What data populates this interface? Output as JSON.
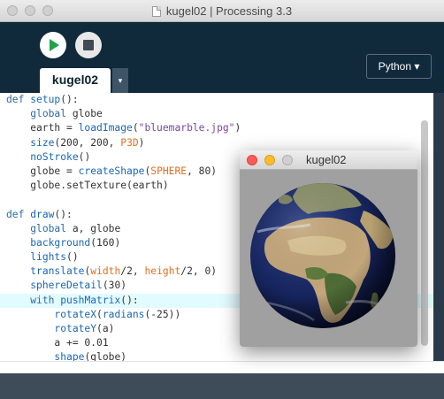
{
  "window": {
    "title": "kugel02 | Processing 3.3"
  },
  "toolbar": {
    "run_label": "Run",
    "stop_label": "Stop",
    "mode_label": "Python ▾"
  },
  "tabs": [
    {
      "label": "kugel02"
    }
  ],
  "tab_menu_glyph": "▾",
  "code_lines": [
    "def setup():",
    "    global globe",
    "    earth = loadImage(\"bluemarble.jpg\")",
    "    size(200, 200, P3D)",
    "    noStroke()",
    "    globe = createShape(SPHERE, 80)",
    "    globe.setTexture(earth)",
    "",
    "def draw():",
    "    global a, globe",
    "    background(160)",
    "    lights()",
    "    translate(width/2, height/2, 0)",
    "    sphereDetail(30)",
    "    with pushMatrix():",
    "        rotateX(radians(-25))",
    "        rotateY(a)",
    "        a += 0.01",
    "        shape(globe)"
  ],
  "highlighted_line": 14,
  "sketch_window": {
    "title": "kugel02",
    "background_color": "#a0a0a0"
  },
  "colors": {
    "toolbar_bg": "#102a3c",
    "run_green": "#1fa34a",
    "keyword_blue": "#2c6aa4",
    "function_orange": "#e07020",
    "string_purple": "#7d4698",
    "highlight_line": "#e2fbff"
  }
}
